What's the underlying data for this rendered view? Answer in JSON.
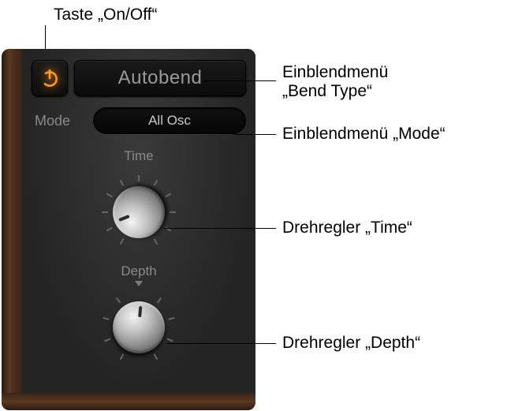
{
  "panel": {
    "bend_type": "Autobend",
    "mode_label": "Mode",
    "mode_value": "All Osc",
    "time_label": "Time",
    "depth_label": "Depth",
    "accent_color": "#ff9a1a"
  },
  "callouts": {
    "onoff": "Taste „On/Off“",
    "bendtype_a": "Einblendmenü",
    "bendtype_b": "„Bend Type“",
    "mode": "Einblendmenü „Mode“",
    "time": "Drehregler „Time“",
    "depth": "Drehregler „Depth“"
  }
}
